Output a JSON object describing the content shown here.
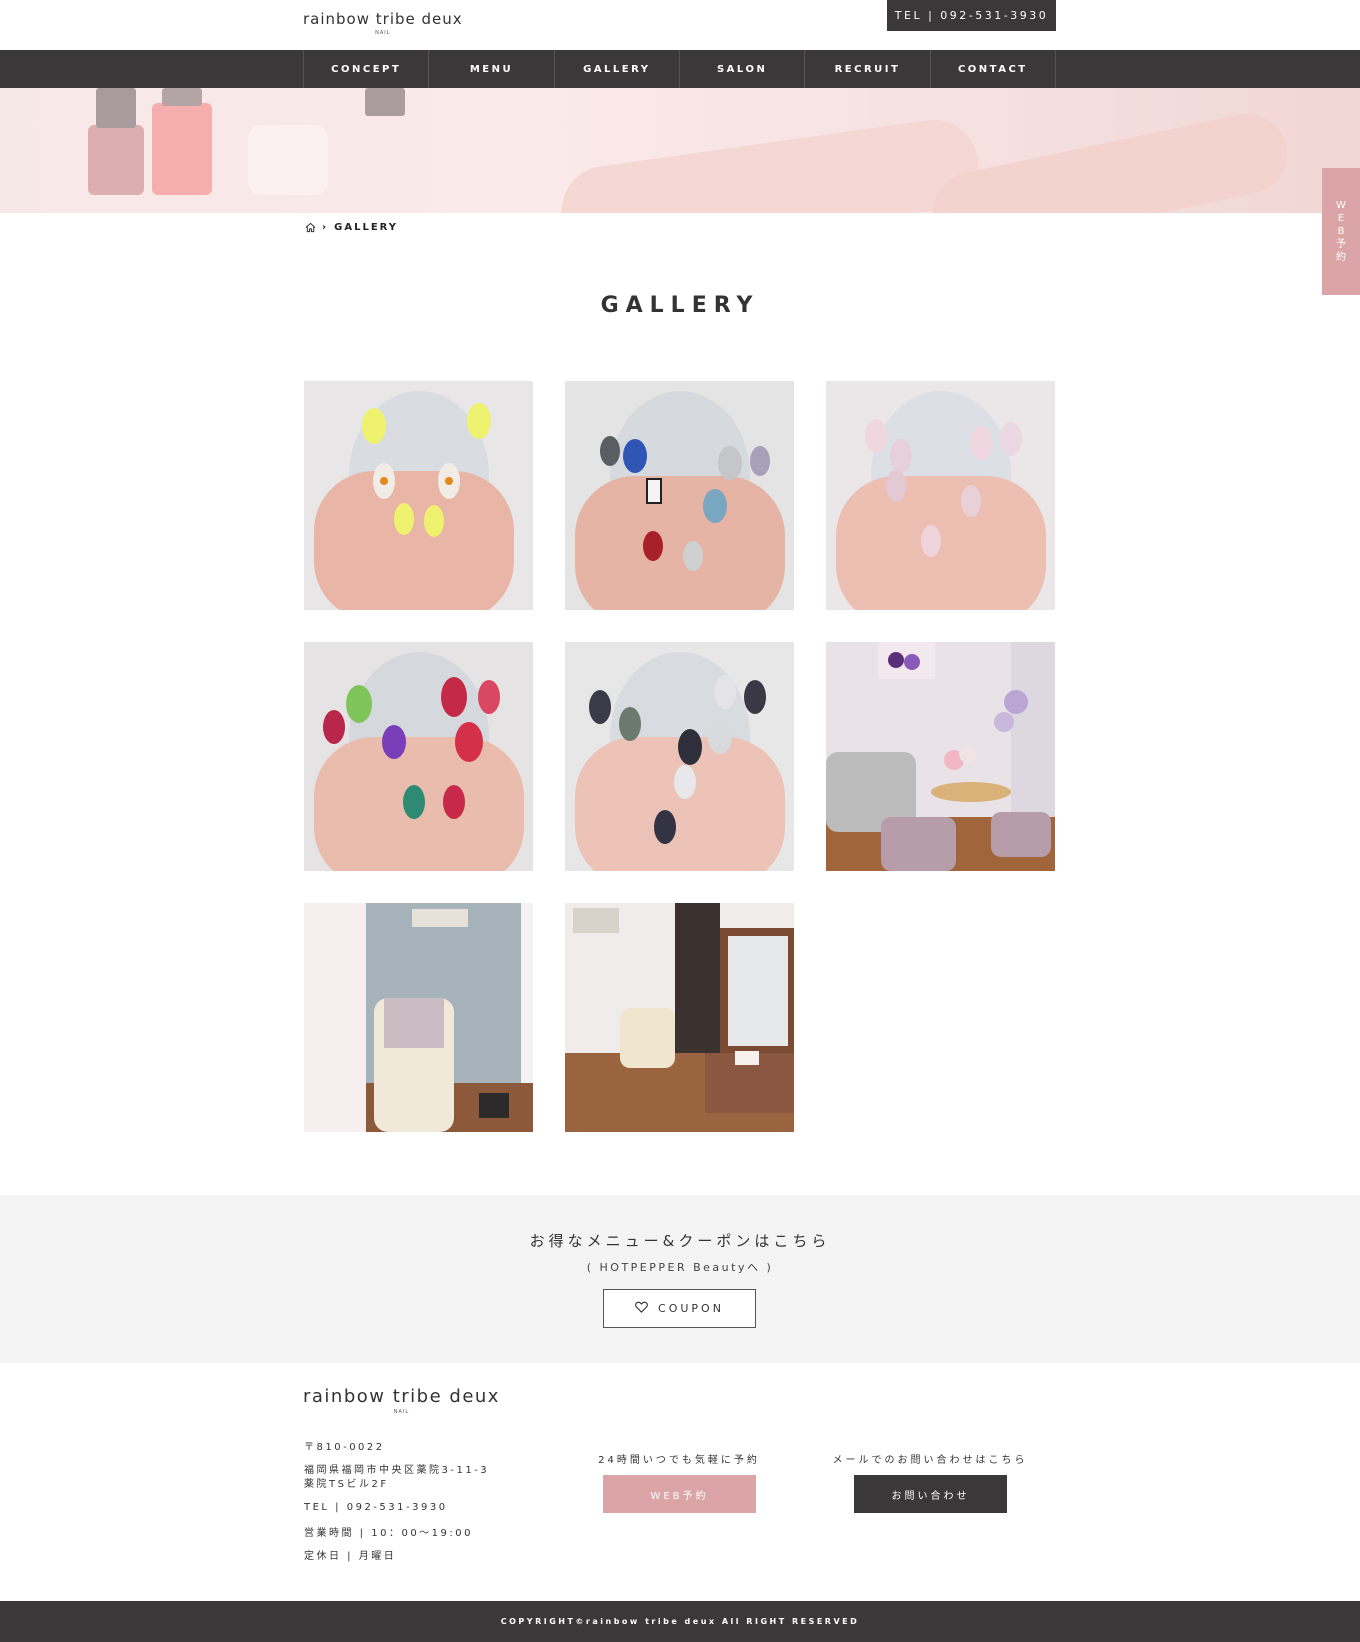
{
  "header": {
    "logo_name": "rainbow tribe deux",
    "logo_sub": "NAIL",
    "tel": "TEL | 092-531-3930"
  },
  "nav": {
    "items": [
      "CONCEPT",
      "MENU",
      "GALLERY",
      "SALON",
      "RECRUIT",
      "CONTACT"
    ]
  },
  "side_tab": {
    "chars": [
      "W",
      "E",
      "B",
      "予",
      "約"
    ]
  },
  "breadcrumb": {
    "home_icon": "home-icon",
    "current": "GALLERY"
  },
  "page": {
    "title": "GALLERY"
  },
  "gallery": {
    "images": [
      {
        "subject": "nails-yellow-flower"
      },
      {
        "subject": "nails-blue-stone"
      },
      {
        "subject": "nails-pink-sheer"
      },
      {
        "subject": "nails-red-green"
      },
      {
        "subject": "nails-black-glitter"
      },
      {
        "subject": "salon-lounge"
      },
      {
        "subject": "salon-chair"
      },
      {
        "subject": "salon-vanity"
      }
    ]
  },
  "coupon": {
    "title": "お得なメニュー&クーポンはこちら",
    "subtitle": "( HOTPEPPER Beautyへ )",
    "button_label": "COUPON",
    "button_icon": "heart-icon"
  },
  "footer": {
    "logo_name": "rainbow tribe deux",
    "logo_sub": "NAIL",
    "postal": "〒810-0022",
    "address_line1": "福岡県福岡市中央区薬院3-11-3",
    "address_line2": "薬院TSビル2F",
    "tel": "TEL | 092-531-3930",
    "hours": "営業時間 | 10：00〜19:00",
    "closed": "定休日 | 月曜日",
    "web_label": "24時間いつでも気軽に予約",
    "web_button": "WEB予約",
    "mail_label": "メールでのお問い合わせはこちら",
    "mail_button": "お問い合わせ",
    "copyright": "COPYRIGHT©rainbow tribe deux All RIGHT RESERVED"
  },
  "colors": {
    "dark": "#3b3839",
    "pink": "#dba4a6",
    "band": "#f4f4f4"
  }
}
